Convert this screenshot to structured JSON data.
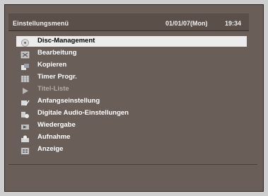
{
  "header": {
    "title": "Einstellungsmenü",
    "date": "01/01/07(Mon)",
    "time": "19:34"
  },
  "menu": {
    "items": [
      {
        "label": "Disc-Management",
        "icon": "disc-icon",
        "selected": true,
        "disabled": false
      },
      {
        "label": "Bearbeitung",
        "icon": "edit-icon",
        "selected": false,
        "disabled": false
      },
      {
        "label": "Kopieren",
        "icon": "copy-icon",
        "selected": false,
        "disabled": false
      },
      {
        "label": "Timer Progr.",
        "icon": "timer-icon",
        "selected": false,
        "disabled": false
      },
      {
        "label": "Titel-Liste",
        "icon": "play-icon",
        "selected": false,
        "disabled": true
      },
      {
        "label": "Anfangseinstellung",
        "icon": "setup-icon",
        "selected": false,
        "disabled": false
      },
      {
        "label": "Digitale Audio-Einstellungen",
        "icon": "audio-icon",
        "selected": false,
        "disabled": false
      },
      {
        "label": "Wiedergabe",
        "icon": "playback-icon",
        "selected": false,
        "disabled": false
      },
      {
        "label": "Aufnahme",
        "icon": "record-icon",
        "selected": false,
        "disabled": false
      },
      {
        "label": "Anzeige",
        "icon": "display-icon",
        "selected": false,
        "disabled": false
      }
    ]
  },
  "colors": {
    "background": "#6a5e58",
    "highlight": "#ececec",
    "text": "#ffffff",
    "disabled_text": "#b3aba6"
  }
}
